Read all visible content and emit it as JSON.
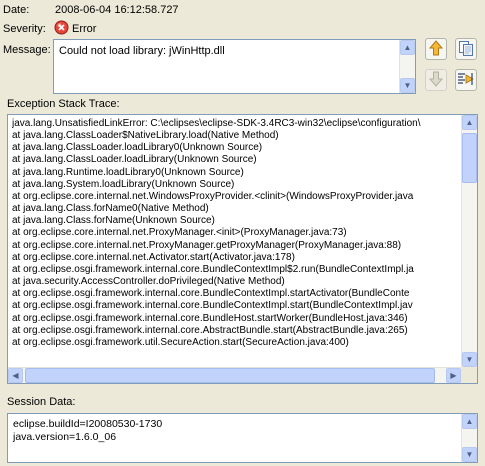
{
  "date": {
    "label": "Date:",
    "value": "2008-06-04 16:12:58.727"
  },
  "severity": {
    "label": "Severity:",
    "value": "Error",
    "icon": "error-icon",
    "icon_color": "#d9261c"
  },
  "message": {
    "label": "Message:",
    "value": "Could not load library: jWinHttp.dll"
  },
  "toolbar": {
    "previous_icon": "arrow-up-icon",
    "next_icon": "arrow-down-icon",
    "copy_icon": "copy-icon",
    "filter_icon": "filter-stack-icon"
  },
  "stack_trace": {
    "label": "Exception Stack Trace:",
    "lines": [
      "java.lang.UnsatisfiedLinkError: C:\\eclipses\\eclipse-SDK-3.4RC3-win32\\eclipse\\configuration\\",
      "at java.lang.ClassLoader$NativeLibrary.load(Native Method)",
      "at java.lang.ClassLoader.loadLibrary0(Unknown Source)",
      "at java.lang.ClassLoader.loadLibrary(Unknown Source)",
      "at java.lang.Runtime.loadLibrary0(Unknown Source)",
      "at java.lang.System.loadLibrary(Unknown Source)",
      "at org.eclipse.core.internal.net.WindowsProxyProvider.<clinit>(WindowsProxyProvider.java",
      "at java.lang.Class.forName0(Native Method)",
      "at java.lang.Class.forName(Unknown Source)",
      "at org.eclipse.core.internal.net.ProxyManager.<init>(ProxyManager.java:73)",
      "at org.eclipse.core.internal.net.ProxyManager.getProxyManager(ProxyManager.java:88)",
      "at org.eclipse.core.internal.net.Activator.start(Activator.java:178)",
      "at org.eclipse.osgi.framework.internal.core.BundleContextImpl$2.run(BundleContextImpl.ja",
      "at java.security.AccessController.doPrivileged(Native Method)",
      "at org.eclipse.osgi.framework.internal.core.BundleContextImpl.startActivator(BundleConte",
      "at org.eclipse.osgi.framework.internal.core.BundleContextImpl.start(BundleContextImpl.jav",
      "at org.eclipse.osgi.framework.internal.core.BundleHost.startWorker(BundleHost.java:346)",
      "at org.eclipse.osgi.framework.internal.core.AbstractBundle.start(AbstractBundle.java:265)",
      "at org.eclipse.osgi.framework.util.SecureAction.start(SecureAction.java:400)"
    ]
  },
  "session": {
    "label": "Session Data:",
    "lines": [
      "eclipse.buildId=I20080530-1730",
      "java.version=1.6.0_06"
    ]
  }
}
